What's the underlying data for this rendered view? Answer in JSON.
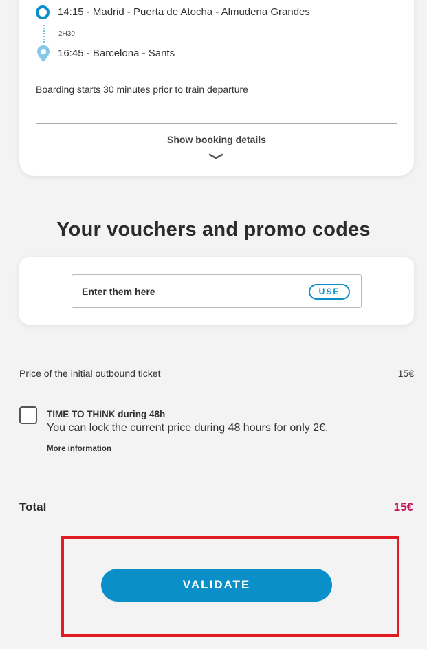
{
  "journey": {
    "departure": {
      "text": "14:15 - Madrid - Puerta de Atocha - Almudena Grandes"
    },
    "duration": "2H30",
    "arrival": {
      "text": "16:45 - Barcelona - Sants"
    },
    "boarding_note": "Boarding starts 30 minutes prior to train departure",
    "show_details_label": "Show booking details"
  },
  "vouchers": {
    "title": "Your vouchers and promo codes",
    "placeholder": "Enter them here",
    "use_label": "USE"
  },
  "pricing": {
    "initial_label": "Price of the initial outbound ticket",
    "initial_value": "15€",
    "time_to_think": {
      "title": "TIME TO THINK during 48h",
      "description": "You can lock the current price during 48 hours for only 2€.",
      "more_info": "More information",
      "checked": false
    },
    "total_label": "Total",
    "total_value": "15€"
  },
  "validate_label": "VALIDATE",
  "colors": {
    "accent": "#0a8fc9",
    "total": "#c8175d",
    "highlight": "#e01b22",
    "background": "#f3f3f3"
  }
}
